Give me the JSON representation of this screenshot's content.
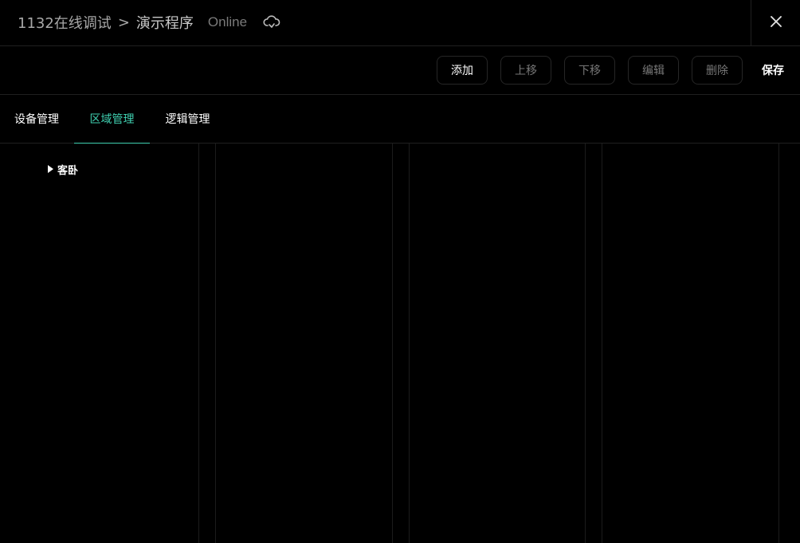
{
  "header": {
    "breadcrumb_parent": "1132在线调试",
    "breadcrumb_separator": ">",
    "breadcrumb_current": "演示程序",
    "status": "Online",
    "status_icon": "cloud-sync-icon",
    "close_icon": "close-icon"
  },
  "toolbar": {
    "add_label": "添加",
    "move_up_label": "上移",
    "move_down_label": "下移",
    "edit_label": "编辑",
    "delete_label": "删除",
    "save_label": "保存"
  },
  "tabs": [
    {
      "label": "设备管理",
      "active": false
    },
    {
      "label": "区域管理",
      "active": true
    },
    {
      "label": "逻辑管理",
      "active": false
    }
  ],
  "tree": {
    "items": [
      {
        "label": "客卧",
        "expanded": false
      }
    ]
  },
  "colors": {
    "accent": "#3fcfb0",
    "background": "#000000",
    "border": "#1f1f1f"
  }
}
